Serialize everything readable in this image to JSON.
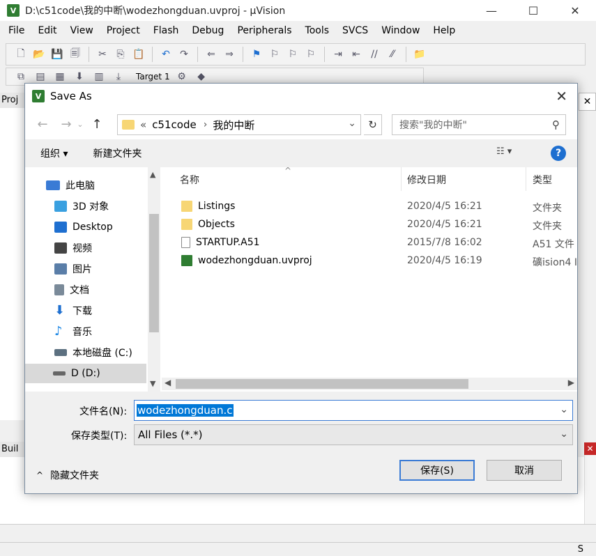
{
  "window": {
    "title": "D:\\c51code\\我的中断\\wodezhongduan.uvproj - µVision",
    "app_icon": "V",
    "controls": [
      "—",
      "☐",
      "✕"
    ]
  },
  "menubar": [
    "File",
    "Edit",
    "View",
    "Project",
    "Flash",
    "Debug",
    "Peripherals",
    "Tools",
    "SVCS",
    "Window",
    "Help"
  ],
  "toolbar": {
    "target": "Target 1"
  },
  "background": {
    "project_tab": "Proj",
    "build_tab": "Buil",
    "status_right": "S"
  },
  "dialog": {
    "title": "Save As",
    "icon": "V",
    "close": "✕",
    "address": {
      "prefix": "«",
      "crumbs": [
        "c51code",
        "我的中断"
      ],
      "separator": "›"
    },
    "search_placeholder": "搜索\"我的中断\"",
    "commands": {
      "organize": "组织 ▾",
      "new_folder": "新建文件夹"
    },
    "nav_items": [
      {
        "label": "此电脑",
        "icon": "computer-icon",
        "color": "#3a7bd5"
      },
      {
        "label": "3D 对象",
        "icon": "3d-objects-icon",
        "color": "#3aa0e0"
      },
      {
        "label": "Desktop",
        "icon": "desktop-icon",
        "color": "#1e6fd0"
      },
      {
        "label": "视频",
        "icon": "video-icon",
        "color": "#444444"
      },
      {
        "label": "图片",
        "icon": "pictures-icon",
        "color": "#5a7ea8"
      },
      {
        "label": "文档",
        "icon": "documents-icon",
        "color": "#7a8a99"
      },
      {
        "label": "下载",
        "icon": "downloads-icon",
        "color": "#1e6fd0"
      },
      {
        "label": "音乐",
        "icon": "music-icon",
        "color": "#1e88e5"
      },
      {
        "label": "本地磁盘 (C:)",
        "icon": "drive-c-icon",
        "color": "#5c7080"
      },
      {
        "label": "D (D:)",
        "icon": "drive-d-icon",
        "color": "#666666"
      }
    ],
    "columns": [
      "名称",
      "修改日期",
      "类型"
    ],
    "files": [
      {
        "name": "Listings",
        "date": "2020/4/5 16:21",
        "type": "文件夹",
        "icon": "folder-icon",
        "color": "#f7d675"
      },
      {
        "name": "Objects",
        "date": "2020/4/5 16:21",
        "type": "文件夹",
        "icon": "folder-icon",
        "color": "#f7d675"
      },
      {
        "name": "STARTUP.A51",
        "date": "2015/7/8 16:02",
        "type": "A51 文件",
        "icon": "file-icon",
        "color": "#ffffff"
      },
      {
        "name": "wodezhongduan.uvproj",
        "date": "2020/4/5 16:19",
        "type": "礦ision4 I",
        "icon": "uvproj-icon",
        "color": "#2f7d32"
      }
    ],
    "filename_label": "文件名(N):",
    "filename_value": "wodezhongduan.c",
    "filetype_label": "保存类型(T):",
    "filetype_value": "All Files (*.*)",
    "hide_folders": "隐藏文件夹",
    "save_button": "保存(S)",
    "cancel_button": "取消"
  }
}
